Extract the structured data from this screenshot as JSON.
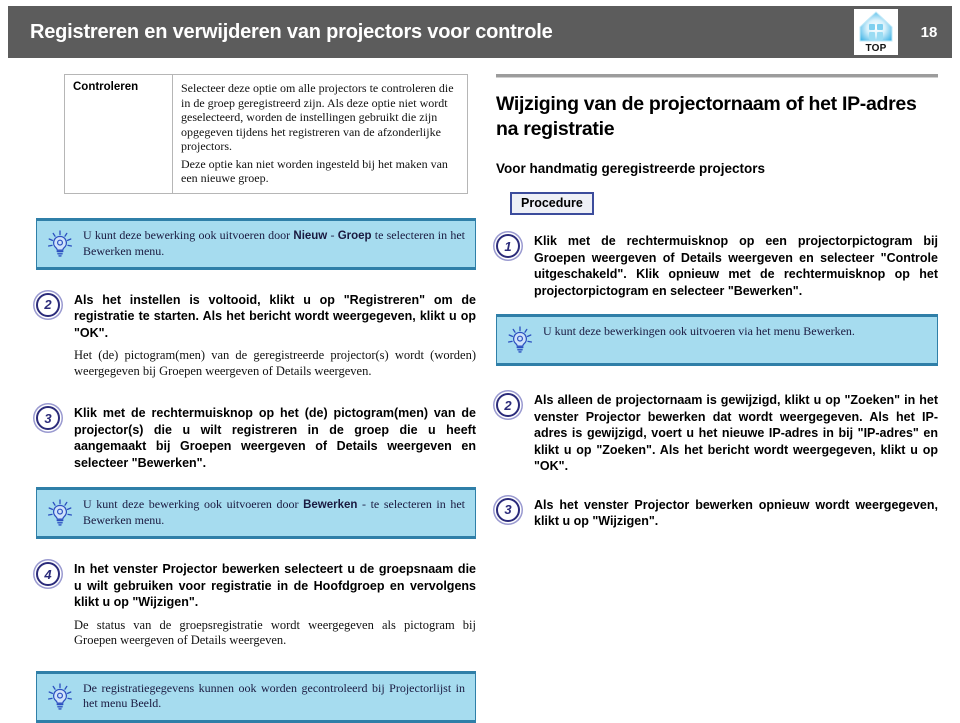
{
  "header": {
    "title": "Registreren en verwijderen van projectors voor controle",
    "page_number": "18",
    "top_icon_label": "TOP",
    "top_icon_name": "projector-top-icon",
    "bar_color": "#5c5c5c"
  },
  "left_column": {
    "table": {
      "rows": [
        {
          "label": "Controleren",
          "paragraphs": [
            "Selecteer deze optie om alle projectors te controleren die in de groep geregistreerd zijn. Als deze optie niet wordt geselecteerd, worden de instellingen gebruikt die zijn opgegeven tijdens het registreren van de afzonderlijke projectors.",
            "Deze optie kan niet worden ingesteld bij het maken van een nieuwe groep."
          ]
        }
      ]
    },
    "tip_1": {
      "icon": "lightbulb-icon",
      "text_before": "U kunt deze bewerking ook uitvoeren door ",
      "bold_1": "Nieuw",
      "text_mid": " - ",
      "bold_2": "Groep",
      "text_after": " te selecteren in het Bewerken menu."
    },
    "step_2": {
      "number": "2",
      "heading": "Als het instellen is voltooid, klikt u op \"Registreren\" om de registratie te starten. Als het bericht wordt weergegeven, klikt u op \"OK\".",
      "note": "Het (de) pictogram(men) van de geregistreerde projector(s) wordt (worden) weergegeven bij Groepen weergeven of Details weergeven."
    },
    "step_3": {
      "number": "3",
      "heading": "Klik met de rechtermuisknop op het (de) pictogram(men) van de projector(s) die u wilt registreren in de groep die u heeft aangemaakt bij Groepen weergeven of Details weergeven en selecteer \"Bewerken\"."
    },
    "tip_2": {
      "icon": "lightbulb-icon",
      "text_before": "U kunt deze bewerking ook uitvoeren door ",
      "bold_1": "Bewerken",
      "text_after": " - te selecteren in het Bewerken menu."
    },
    "step_4": {
      "number": "4",
      "heading": "In het venster Projector bewerken selecteert u de groepsnaam die u wilt gebruiken voor registratie in de Hoofdgroep en vervolgens klikt u op \"Wijzigen\".",
      "note": "De status van de groepsregistratie wordt weergegeven als pictogram bij Groepen weergeven of Details weergeven."
    },
    "tip_3": {
      "icon": "lightbulb-icon",
      "text": "De registratiegegevens kunnen ook worden gecontroleerd bij Projectorlijst in het menu Beeld."
    }
  },
  "right_column": {
    "section_title": "Wijziging van de projectornaam of het IP-adres na registratie",
    "subsection_title": "Voor handmatig geregistreerde projectors",
    "procedure_badge": "Procedure",
    "step_1": {
      "number": "1",
      "heading": "Klik met de rechtermuisknop op een projectorpictogram bij Groepen weergeven of Details weergeven en selecteer \"Controle uitgeschakeld\". Klik opnieuw met de rechtermuisknop op het projectorpictogram en selecteer \"Bewerken\"."
    },
    "tip_1": {
      "icon": "lightbulb-icon",
      "text": "U kunt deze bewerkingen ook uitvoeren via het menu Bewerken."
    },
    "step_2": {
      "number": "2",
      "heading": "Als alleen de projectornaam is gewijzigd, klikt u op \"Zoeken\" in het venster Projector bewerken dat wordt weergegeven. Als het IP-adres is gewijzigd, voert u het nieuwe IP-adres in bij \"IP-adres\" en klikt u op \"Zoeken\". Als het bericht wordt weergegeven, klikt u op \"OK\"."
    },
    "step_3": {
      "number": "3",
      "heading": "Als het venster Projector bewerken opnieuw wordt weergegeven, klikt u op \"Wijzigen\"."
    }
  },
  "colors": {
    "tip_background": "#a6dcef",
    "tip_border": "#2f7fa8",
    "step_circle": "#2b2b7a",
    "rule": "#9c9c9c"
  }
}
